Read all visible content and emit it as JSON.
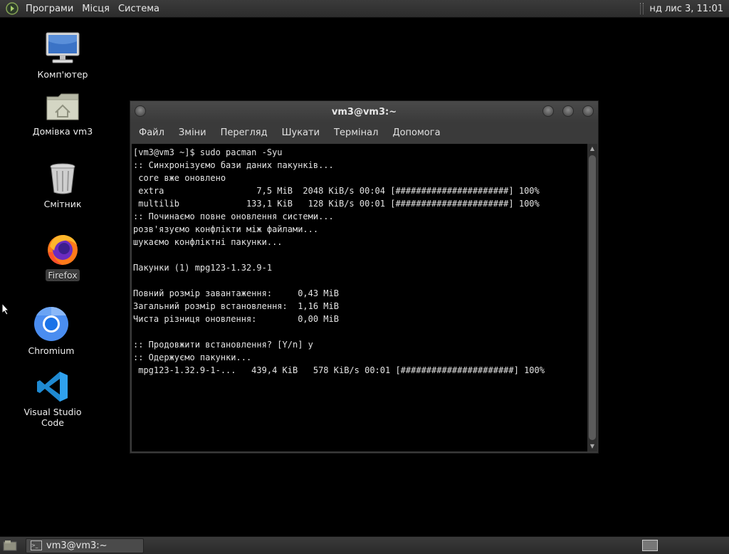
{
  "top_panel": {
    "menus": [
      "Програми",
      "Місця",
      "Система"
    ],
    "clock": "нд лис 3, 11:01"
  },
  "desktop_icons": [
    {
      "label": "Комп'ютер",
      "icon": "computer-icon"
    },
    {
      "label": "Домівка vm3",
      "icon": "home-folder-icon"
    },
    {
      "label": "Смітник",
      "icon": "trash-icon"
    },
    {
      "label": "Firefox",
      "icon": "firefox-icon"
    },
    {
      "label": "Chromium",
      "icon": "chromium-icon"
    },
    {
      "label": "Visual Studio Code",
      "icon": "vscode-icon"
    }
  ],
  "terminal": {
    "title": "vm3@vm3:~",
    "menu": [
      "Файл",
      "Зміни",
      "Перегляд",
      "Шукати",
      "Термінал",
      "Допомога"
    ],
    "lines": [
      "[vm3@vm3 ~]$ sudo pacman -Syu",
      ":: Синхронізуємо бази даних пакунків...",
      " core вже оновлено",
      " extra                  7,5 MiB  2048 KiB/s 00:04 [######################] 100%",
      " multilib             133,1 KiB   128 KiB/s 00:01 [######################] 100%",
      ":: Починаємо повне оновлення системи...",
      "розв'язуємо конфлікти між файлами...",
      "шукаємо конфліктні пакунки...",
      "",
      "Пакунки (1) mpg123-1.32.9-1",
      "",
      "Повний розмір завантаження:     0,43 MiB",
      "Загальний розмір встановлення:  1,16 MiB",
      "Чиста різниця оновлення:        0,00 MiB",
      "",
      ":: Продовжити встановлення? [Y/n] y",
      ":: Одержуємо пакунки...",
      " mpg123-1.32.9-1-...   439,4 KiB   578 KiB/s 00:01 [######################] 100%"
    ]
  },
  "taskbar": {
    "task_label": "vm3@vm3:~"
  },
  "colors": {
    "panel": "#333333",
    "terminal_bg": "#000000",
    "terminal_fg": "#e4e4e4"
  }
}
